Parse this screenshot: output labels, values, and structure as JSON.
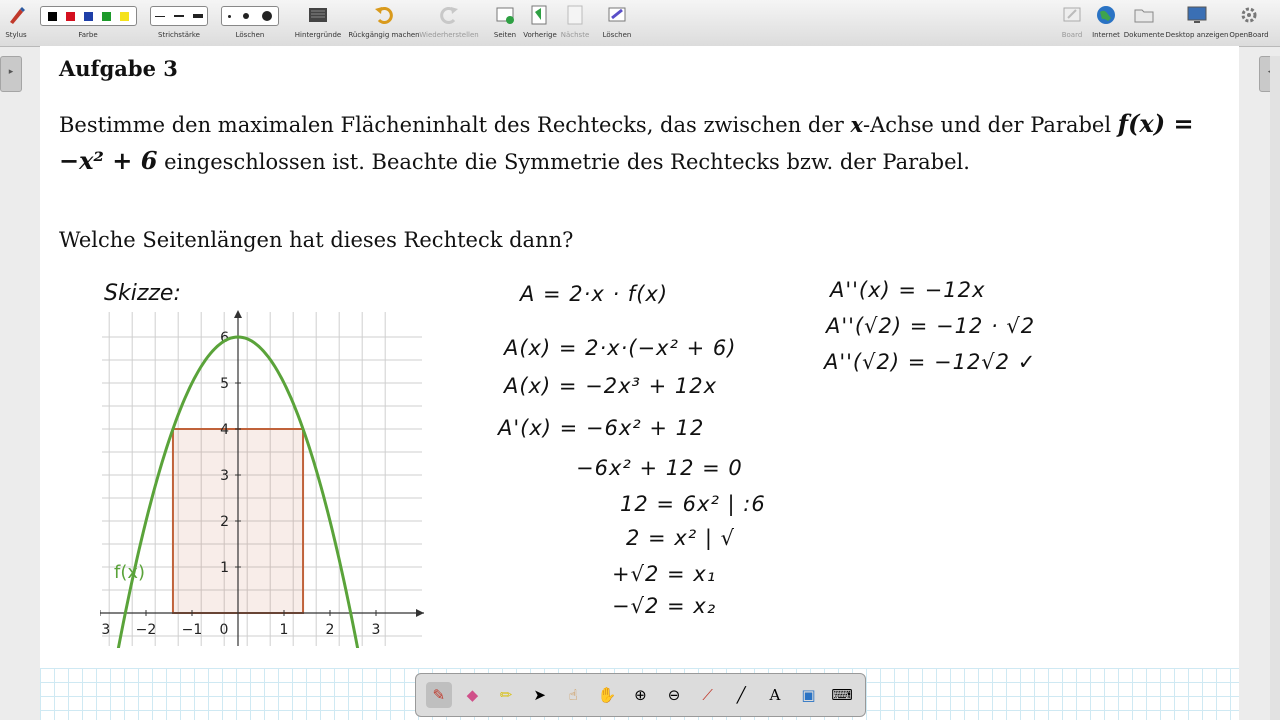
{
  "toolbar": {
    "stylus": "Stylus",
    "farbe": "Farbe",
    "strichstaerke": "Strichstärke",
    "loeschen1": "Löschen",
    "hintergruende": "Hintergründe",
    "rueckgaengig": "Rückgängig machen",
    "wiederherstellen": "Wiederherstellen",
    "seiten": "Seiten",
    "vorherige": "Vorherige",
    "naechste": "Nächste",
    "loeschen2": "Löschen",
    "board": "Board",
    "internet": "Internet",
    "dokumente": "Dokumente",
    "desktop": "Desktop anzeigen",
    "openboard": "OpenBoard",
    "colors": [
      "#000000",
      "#d4101f",
      "#1f3fa8",
      "#1d9a2a",
      "#f5e21b"
    ]
  },
  "page": {
    "title": "Aufgabe 3",
    "task_part1": "Bestimme den maximalen Flächeninhalt des Rechtecks, das zwischen der ",
    "task_x": "x",
    "task_part2": "-Achse und der Parabel ",
    "task_formula": "f(x) = −x² + 6",
    "task_part3": " eingeschlossen ist. Beachte die Symmetrie des Rechtecks bzw. der Parabel.",
    "question": "Welche Seitenlängen hat dieses Rechteck dann?",
    "sketch_label": "Skizze:",
    "function_label": "f(x)"
  },
  "chart_data": {
    "type": "line",
    "title": "",
    "xlabel": "",
    "ylabel": "",
    "xlim": [
      -3.3,
      3.6
    ],
    "ylim": [
      -0.8,
      6.4
    ],
    "x_ticks": [
      -3,
      -2,
      -1,
      0,
      1,
      2,
      3
    ],
    "y_ticks": [
      1,
      2,
      3,
      4,
      5,
      6
    ],
    "grid": true,
    "series": [
      {
        "name": "f(x)",
        "function": "-x^2 + 6",
        "color": "#5aa33a"
      }
    ],
    "rectangle": {
      "x_from": -1.414,
      "x_to": 1.414,
      "height": 4
    }
  },
  "handwriting": {
    "left": [
      "A = 2·x · f(x)",
      "A(x) = 2·x·(−x² + 6)",
      "A(x) = −2x³ + 12x",
      "A'(x) = −6x² + 12",
      "−6x² + 12 = 0",
      "12 = 6x²  | :6",
      "2 = x²  | √",
      "+√2 = x₁",
      "−√2 = x₂"
    ],
    "right": [
      "A''(x) = −12x",
      "A''(√2) = −12 · √2",
      "A''(√2) = −12√2 ✓"
    ]
  }
}
